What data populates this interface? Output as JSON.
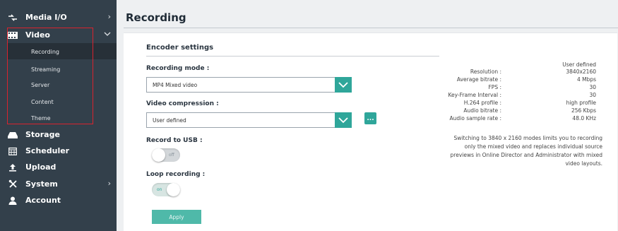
{
  "sidebar": {
    "items": [
      {
        "label": "Media I/O",
        "icon": "media-io-icon",
        "arrow": "›"
      },
      {
        "label": "Video",
        "icon": "video-icon",
        "arrow": "⌄"
      },
      {
        "label": "Storage",
        "icon": "storage-icon"
      },
      {
        "label": "Scheduler",
        "icon": "scheduler-icon"
      },
      {
        "label": "Upload",
        "icon": "upload-icon"
      },
      {
        "label": "System",
        "icon": "system-icon",
        "arrow": "›"
      },
      {
        "label": "Account",
        "icon": "account-icon"
      }
    ],
    "video_subitems": [
      "Recording",
      "Streaming",
      "Server",
      "Content",
      "Theme"
    ],
    "active_subitem": "Recording"
  },
  "page": {
    "title": "Recording"
  },
  "encoder": {
    "section_title": "Encoder settings",
    "recording_mode_label": "Recording mode :",
    "recording_mode_value": "MP4 Mixed video",
    "compression_label": "Video compression :",
    "compression_value": "User defined",
    "more_button": "...",
    "usb_label": "Record to USB :",
    "usb_toggle": "off",
    "loop_label": "Loop recording :",
    "loop_toggle": "on",
    "apply_label": "Apply"
  },
  "info": {
    "header": "User defined",
    "rows": [
      {
        "key": "Resolution :",
        "value": "3840x2160"
      },
      {
        "key": "Average bitrate :",
        "value": "4 Mbps"
      },
      {
        "key": "FPS :",
        "value": "30"
      },
      {
        "key": "Key-Frame Interval :",
        "value": "30"
      },
      {
        "key": "H.264 profile :",
        "value": "high profile"
      },
      {
        "key": "Audio bitrate :",
        "value": "256 Kbps"
      },
      {
        "key": "Audio sample rate :",
        "value": "48.0 KHz"
      }
    ],
    "note": "Switching to 3840 x 2160 modes limits you to recording only the mixed video and replaces individual source previews in Online Director and Administrator with mixed video layouts."
  },
  "colors": {
    "sidebar_bg": "#33404b",
    "accent": "#2fa69a",
    "highlight": "#d9232e"
  }
}
